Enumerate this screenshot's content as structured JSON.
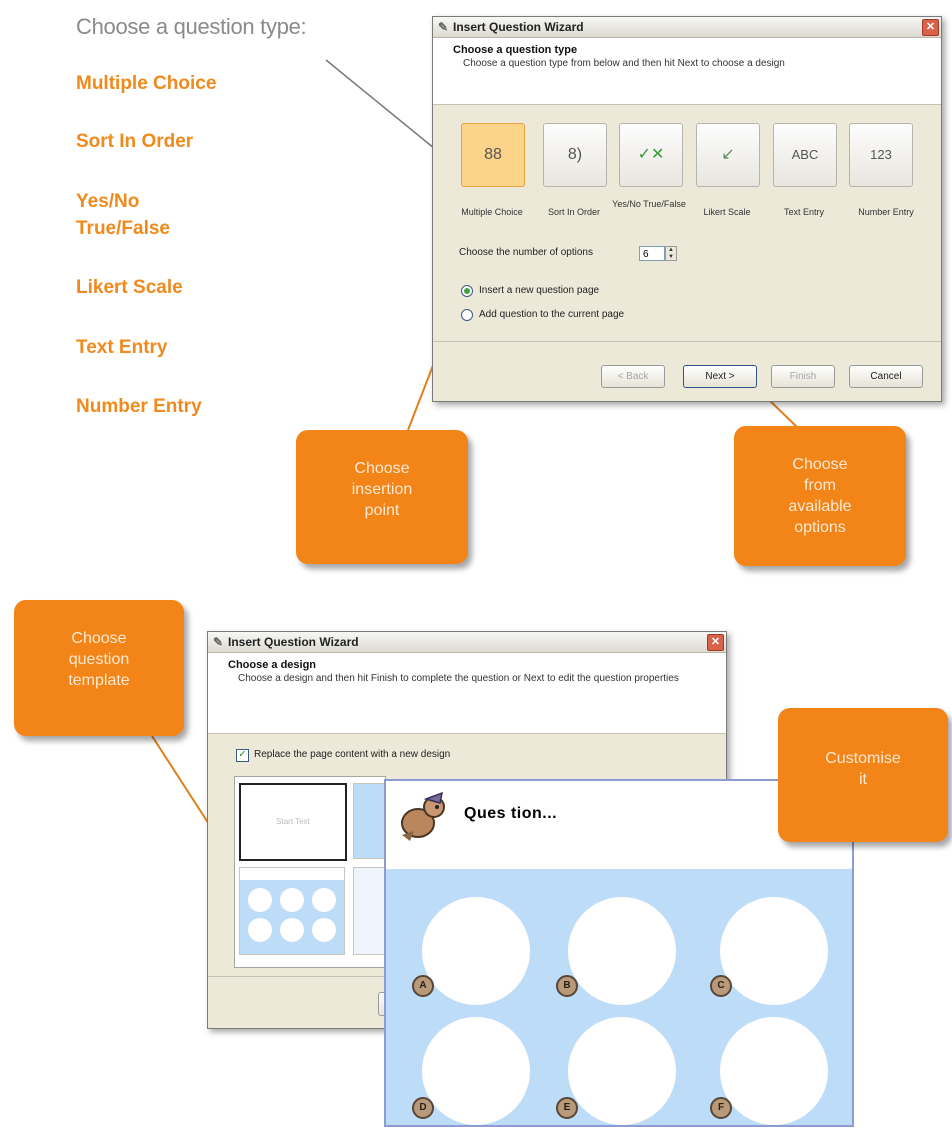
{
  "intro_text": "Choose a question  type:",
  "question_types": [
    "Multiple Choice",
    "Sort In Order",
    "Yes/No",
    "True/False",
    "Likert Scale",
    "Text Entry",
    "Number Entry"
  ],
  "wizard1": {
    "title": "Insert Question Wizard",
    "header_title": "Choose a question type",
    "header_subtitle": "Choose a question type from below and then hit Next to choose a design",
    "icons": [
      {
        "glyph": "88",
        "label": "Multiple Choice",
        "name": "multiple-choice"
      },
      {
        "glyph": "8)",
        "label": "Sort In Order",
        "name": "sort-in-order"
      },
      {
        "glyph": "✓✕",
        "label": "Yes/No True/False",
        "name": "yes-no"
      },
      {
        "glyph": "↙",
        "label": "Likert Scale",
        "name": "likert-scale"
      },
      {
        "glyph": "ABC",
        "label": "Text Entry",
        "name": "text-entry"
      },
      {
        "glyph": "123",
        "label": "Number Entry",
        "name": "number-entry"
      }
    ],
    "options_label": "Choose the number of options",
    "options_value": "6",
    "radio_insert_new": "Insert a new question page",
    "radio_add_current": "Add question to the current page",
    "buttons": {
      "back": "< Back",
      "next": "Next >",
      "finish": "Finish",
      "cancel": "Cancel"
    }
  },
  "callouts": {
    "insertion": [
      "Choose",
      "insertion",
      "point"
    ],
    "options": [
      "Choose",
      "from",
      "available",
      "options"
    ],
    "template": [
      "Choose",
      "question",
      "template"
    ],
    "customise": [
      "Customise",
      "it"
    ]
  },
  "wizard2": {
    "title": "Insert Question Wizard",
    "header_title": "Choose a design",
    "header_subtitle": "Choose a design and then hit Finish to complete the question or Next to edit the question properties",
    "replace_label": "Replace the page content with a new design",
    "template_text": "Start Text"
  },
  "preview": {
    "title": "Ques tion...",
    "badges": [
      "A",
      "B",
      "C",
      "D",
      "E",
      "F"
    ]
  },
  "colors": {
    "accent": "#f28418",
    "selected": "#fcd489",
    "preview_bg": "#bcdcf8"
  }
}
